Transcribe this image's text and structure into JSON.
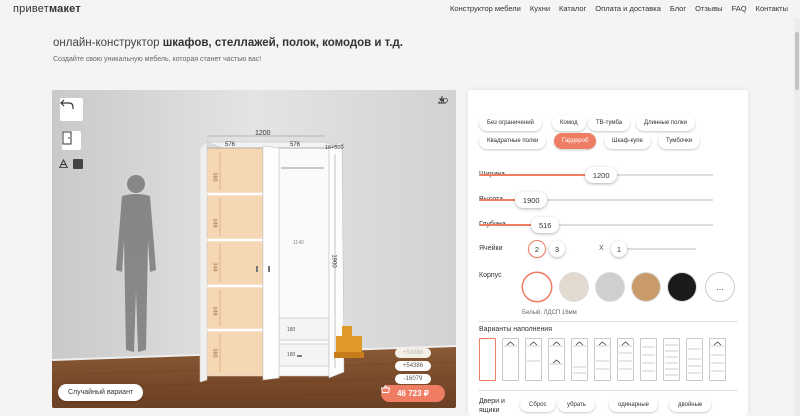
{
  "header": {
    "logo_thin": "привет",
    "logo_bold": "макет",
    "nav": [
      "Конструктор мебели",
      "Кухни",
      "Каталог",
      "Оплата и доставка",
      "Блог",
      "Отзывы",
      "FAQ",
      "Контакты"
    ]
  },
  "hero": {
    "title_prefix": "онлайн-конструктор ",
    "title_bold": "шкафов, стеллажей, полок, комодов и т.д.",
    "subtitle": "Создайте свою уникальную мебель, которая станет частью вас!"
  },
  "scene": {
    "view_3d_label": "3D",
    "dimension_labels": {
      "width_total": "1200",
      "width_left": "576",
      "width_right": "576",
      "depth": "16+500",
      "height_total": "1900",
      "section_heights": [
        "380",
        "348",
        "348",
        "348",
        "380"
      ],
      "right_section": "1140",
      "right_lower": "180",
      "right_bottom": "180"
    },
    "random_button": "Случайный вариант",
    "price_hint_1": "+54386",
    "price_hint_2": "+54386",
    "price_hint_3": "-16079",
    "price": "46 723 ₽"
  },
  "panel": {
    "types": [
      {
        "label": "Без ограничений",
        "active": false
      },
      {
        "label": "Комод",
        "active": false
      },
      {
        "label": "ТВ-тумба",
        "active": false
      },
      {
        "label": "Длинные полки",
        "active": false
      },
      {
        "label": "Квадратные полки",
        "active": false
      },
      {
        "label": "Гардероб",
        "active": true
      },
      {
        "label": "Шкаф-купе",
        "active": false
      },
      {
        "label": "Тумбочки",
        "active": false
      }
    ],
    "width": {
      "label": "Ширина",
      "value": "1200",
      "fraction": 0.52
    },
    "height": {
      "label": "Высота",
      "value": "1900",
      "fraction": 0.22
    },
    "depth": {
      "label": "Глубина",
      "value": "516",
      "fraction": 0.28
    },
    "cells": {
      "label": "Ячейки",
      "options": [
        "2",
        "3"
      ],
      "selected": "2",
      "x_sign": "X",
      "count": "1"
    },
    "body": {
      "label": "Корпус",
      "swatches": [
        "#ffffff",
        "#e2d9cf",
        "#cfcfcf",
        "#c99b6a",
        "#1b1b1b"
      ],
      "selected_index": 0,
      "caption": "Белый. ЛДСП 16мм",
      "more": "..."
    },
    "filling": {
      "label": "Варианты наполнения"
    },
    "doors": {
      "label_line1": "Двери и",
      "label_line2": "ящики",
      "buttons": [
        "Сброс",
        "убрать",
        "одинарные",
        "двойные"
      ]
    }
  }
}
